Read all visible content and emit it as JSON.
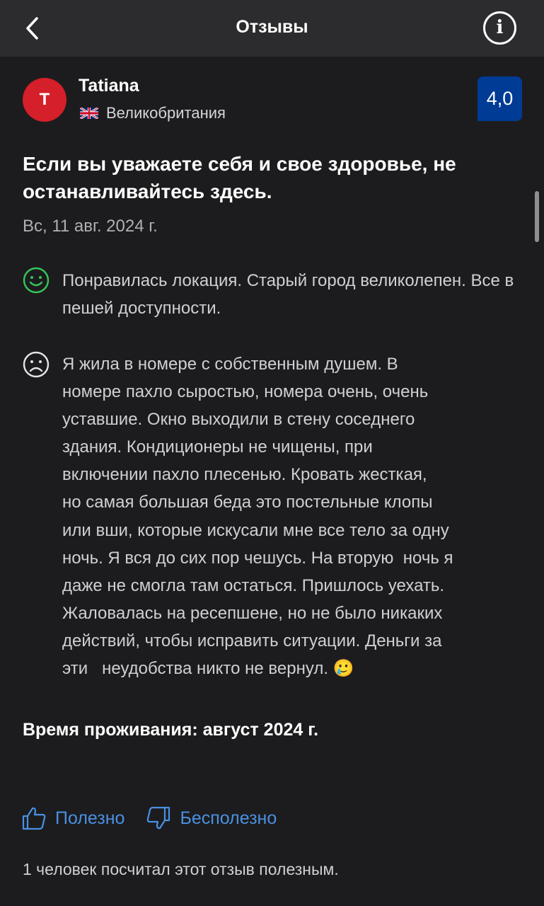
{
  "header": {
    "title": "Отзывы",
    "back_icon": "chevron-left-icon",
    "info_icon": "info-icon"
  },
  "review": {
    "author": {
      "initial": "T",
      "name": "Tatiana",
      "country": "Великобритания",
      "flag_icon": "uk-flag-icon",
      "avatar_color": "#d51f2a"
    },
    "score": "4,0",
    "score_color": "#003b95",
    "title": "Если вы уважаете себя и свое здоровье, не останавливайтесь здесь.",
    "date": "Вс, 11 авг. 2024 г.",
    "positive": {
      "icon": "smile-icon",
      "icon_color": "#34c759",
      "text": "Понравилась локация. Старый город великолепен. Все в пешей доступности."
    },
    "negative": {
      "icon": "frown-icon",
      "lines": [
        "Я жила в номере с собственным душем. В",
        "номере пахло сыростью, номера очень, очень",
        "уставшие. Окно выходили в стену соседнего",
        "здания. Кондиционеры не чищены, при",
        "включении пахло плесенью. Кровать жесткая,",
        "но самая большая беда это постельные клопы",
        "или вши, которые искусали мне все тело за одну",
        "ночь. Я вся до сих пор чешусь. На вторую  ночь я",
        "даже не смогла там остаться. Пришлось уехать.",
        "Жаловалась на ресепшене, но не было никаких",
        "действий, чтобы исправить ситуации. Деньги за",
        "эти   неудобства никто не вернул. 🥲"
      ]
    },
    "stay": "Время проживания: август 2024 г."
  },
  "actions": {
    "helpful_label": "Полезно",
    "helpful_icon": "thumbs-up-icon",
    "unhelpful_label": "Бесполезно",
    "unhelpful_icon": "thumbs-down-icon",
    "link_color": "#4a90e2"
  },
  "footer": {
    "helpful_count_text": "1 человек посчитал этот отзыв полезным."
  }
}
